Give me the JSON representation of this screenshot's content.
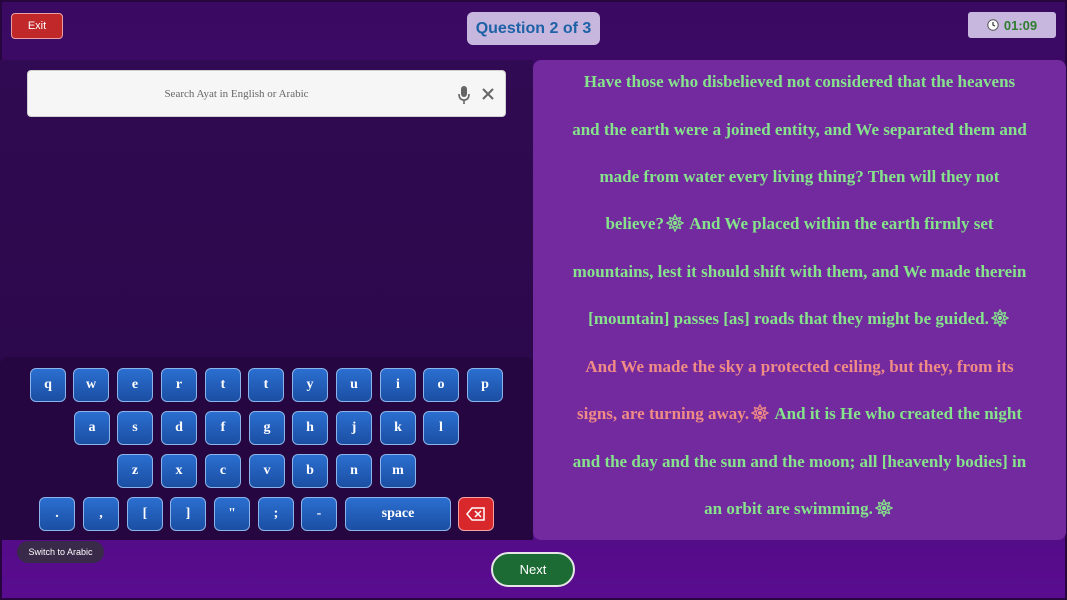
{
  "header": {
    "exit_label": "Exit",
    "question_label": "Question 2 of 3",
    "timer": "01:09"
  },
  "search": {
    "placeholder": "Search Ayat in English or Arabic",
    "mic_icon": "mic-icon",
    "clear_icon": "close-icon"
  },
  "keyboard": {
    "row1": [
      "q",
      "w",
      "e",
      "r",
      "t",
      "t",
      "y",
      "u",
      "i",
      "o",
      "p"
    ],
    "row2": [
      "a",
      "s",
      "d",
      "f",
      "g",
      "h",
      "j",
      "k",
      "l"
    ],
    "row3": [
      "z",
      "x",
      "c",
      "v",
      "b",
      "n",
      "m"
    ],
    "row4": [
      ".",
      ",",
      "[",
      "]",
      "\"",
      ";",
      "-"
    ],
    "space_label": "space",
    "backspace_icon": "backspace-icon",
    "switch_label": "Switch to Arabic"
  },
  "verse": {
    "lines": [
      "Have those who disbelieved not considered that the heavens",
      "and the earth were a joined entity, and We separated them and",
      "made from water every living thing? Then will they not",
      "believe?",
      "And We placed within the earth firmly set",
      "mountains, lest it should shift with them, and We made therein",
      "[mountain] passes [as] roads that they might be guided.",
      "And We made the sky a protected ceiling, but they, from its",
      "signs, are turning away.",
      "And it is He who created the night",
      "and the day and the sun and the moon; all [heavenly bodies] in",
      "an orbit are swimming."
    ],
    "colors": {
      "normal": "#86e38c",
      "highlight": "#f08b86",
      "marker": "ayah-end-marker-icon"
    }
  },
  "footer": {
    "next_label": "Next"
  }
}
